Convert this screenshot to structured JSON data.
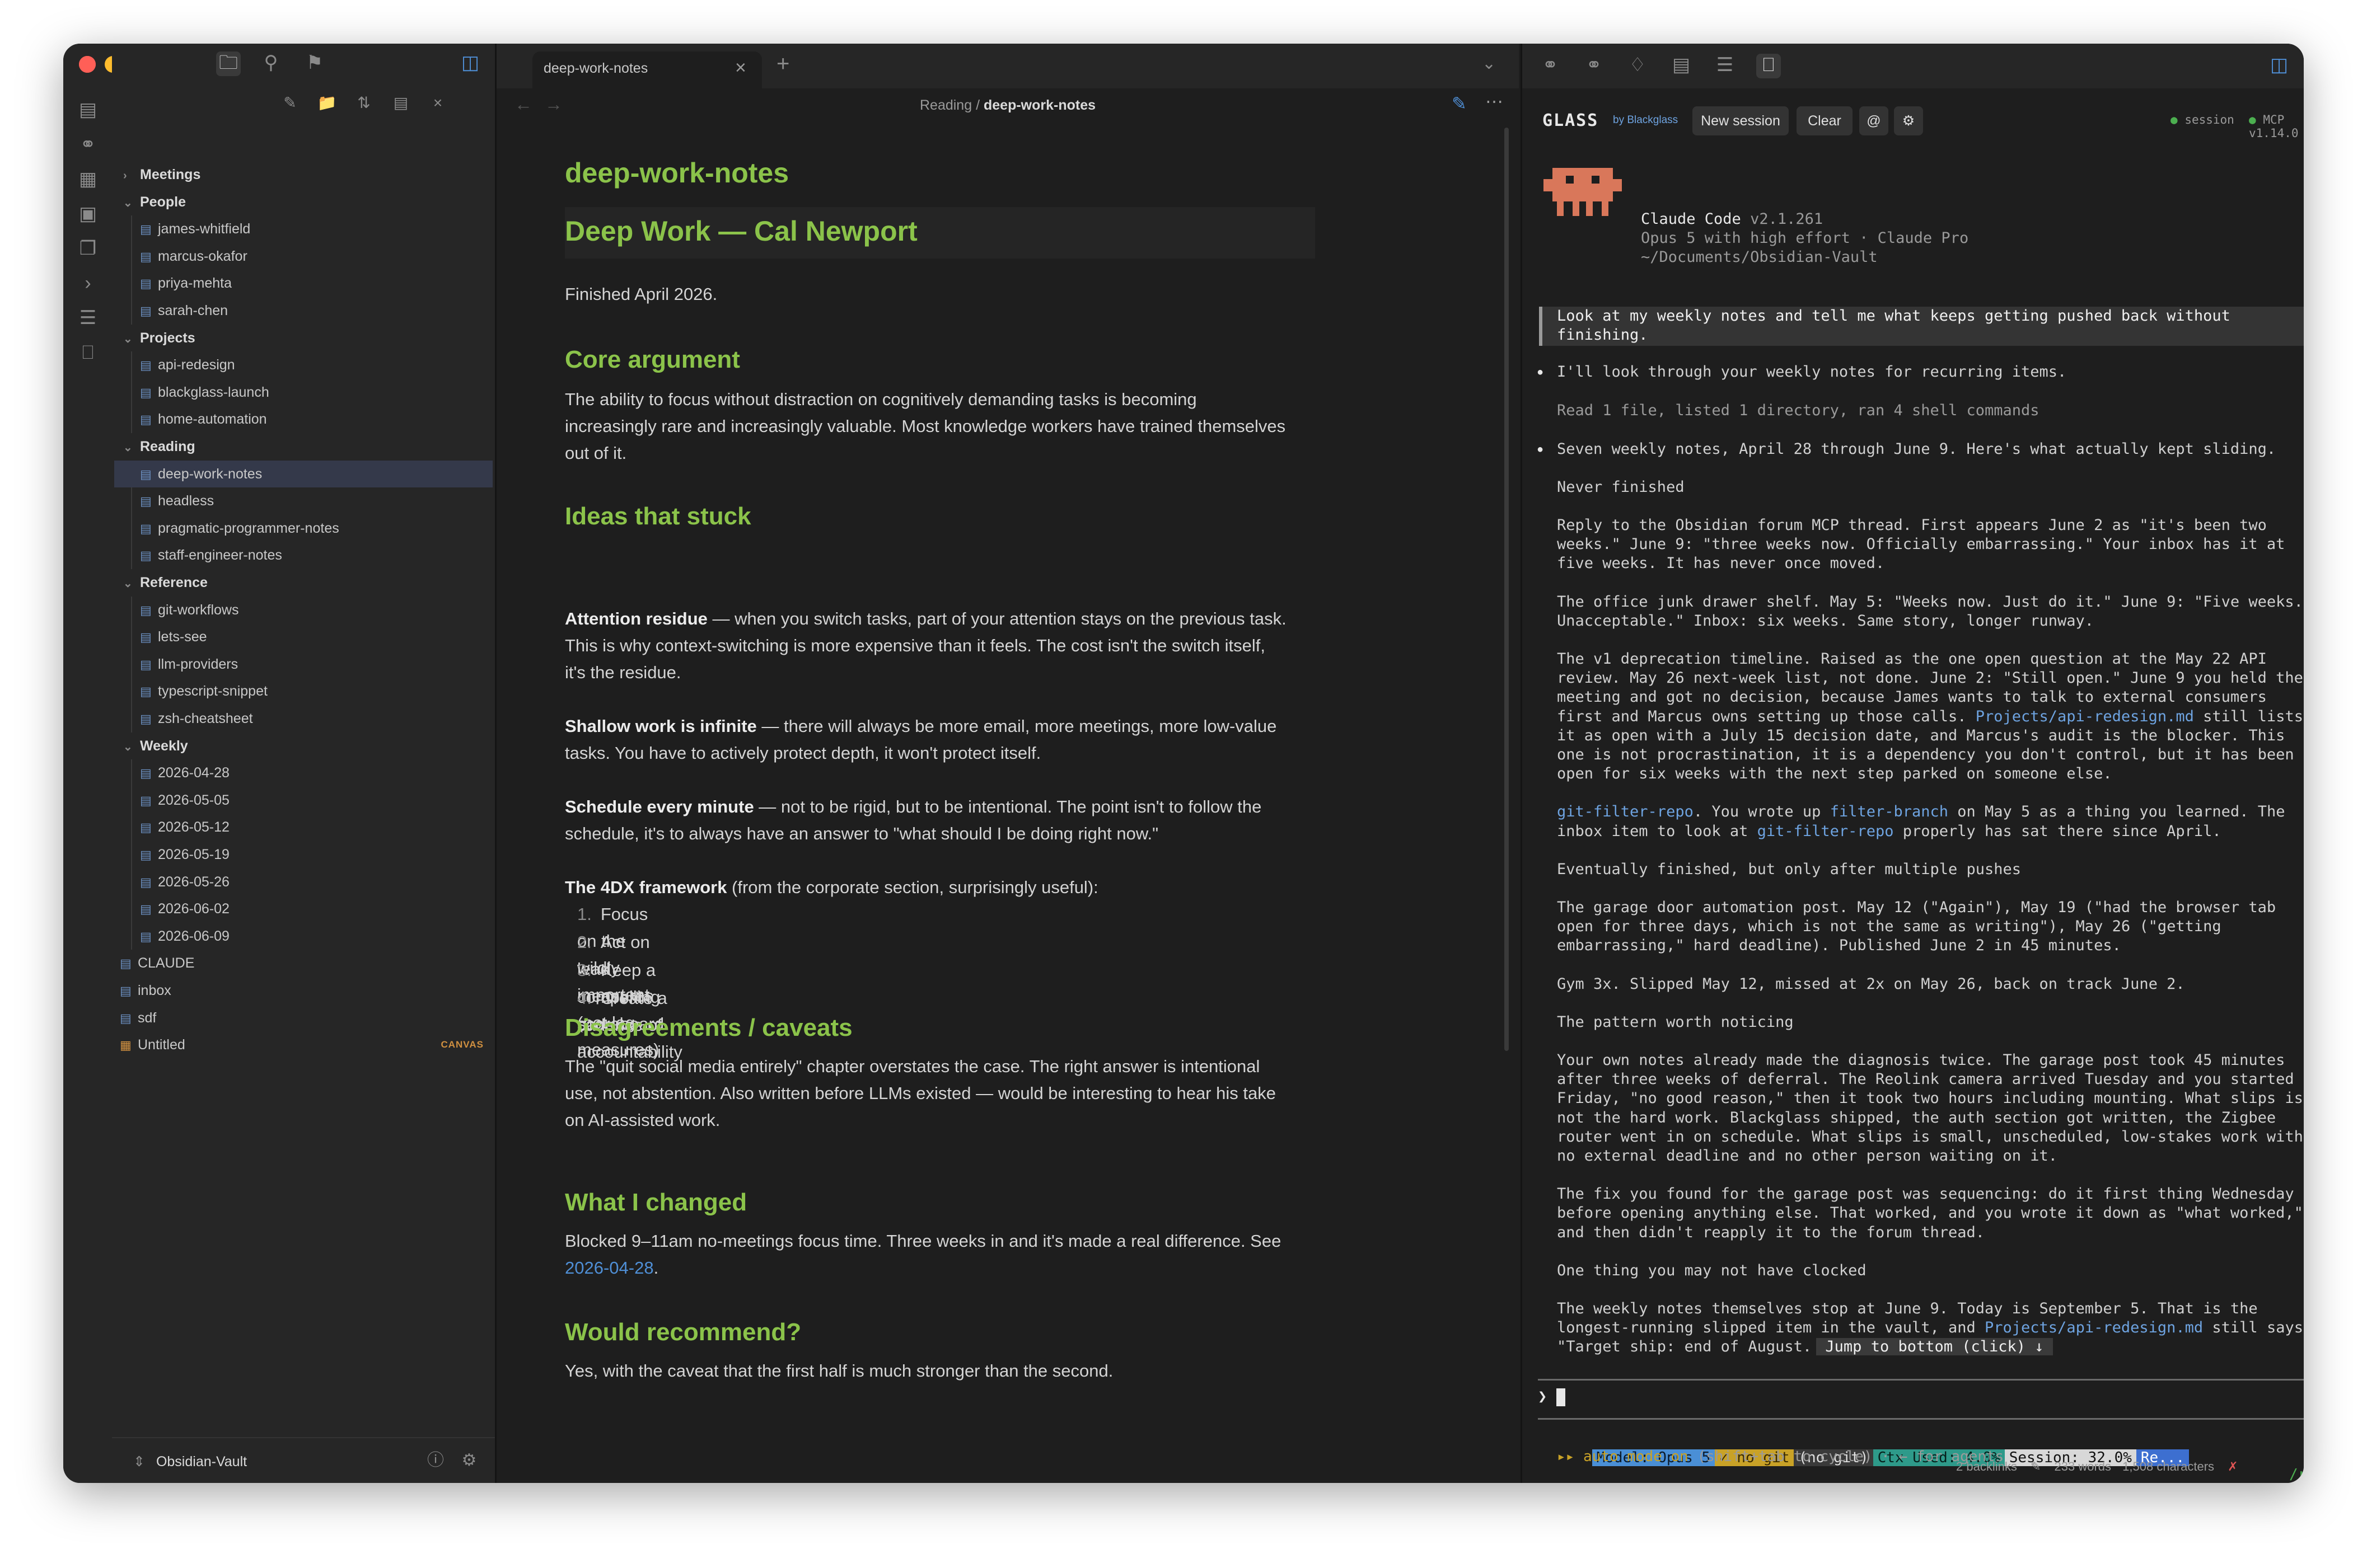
{
  "colors": {
    "accent_green": "#8bc34a",
    "link_blue": "#4f8fd6",
    "traffic_red": "#ff5f57",
    "traffic_yellow": "#febc2e",
    "traffic_green": "#28c840"
  },
  "sidebar": {
    "folders": [
      {
        "label": "Meetings",
        "expanded": false,
        "items": []
      },
      {
        "label": "People",
        "expanded": true,
        "items": [
          "james-whitfield",
          "marcus-okafor",
          "priya-mehta",
          "sarah-chen"
        ]
      },
      {
        "label": "Projects",
        "expanded": true,
        "items": [
          "api-redesign",
          "blackglass-launch",
          "home-automation"
        ]
      },
      {
        "label": "Reading",
        "expanded": true,
        "items": [
          "deep-work-notes",
          "headless",
          "pragmatic-programmer-notes",
          "staff-engineer-notes"
        ]
      },
      {
        "label": "Reference",
        "expanded": true,
        "items": [
          "git-workflows",
          "lets-see",
          "llm-providers",
          "typescript-snippet",
          "zsh-cheatsheet"
        ]
      },
      {
        "label": "Weekly",
        "expanded": true,
        "items": [
          "2026-04-28",
          "2026-05-05",
          "2026-05-12",
          "2026-05-19",
          "2026-05-26",
          "2026-06-02",
          "2026-06-09"
        ]
      }
    ],
    "root_files": [
      "CLAUDE",
      "inbox",
      "sdf"
    ],
    "canvas_file": "Untitled",
    "canvas_badge": "CANVAS",
    "selected": "deep-work-notes",
    "vault_name": "Obsidian-Vault"
  },
  "tab": {
    "title": "deep-work-notes"
  },
  "breadcrumb": {
    "folder": "Reading",
    "sep": "/",
    "file": "deep-work-notes"
  },
  "note": {
    "inline_title": "deep-work-notes",
    "h1": "Deep Work — Cal Newport",
    "finished": "Finished April 2026.",
    "core_h": "Core argument",
    "core_lines": [
      "The ability to focus without distraction on cognitively demanding tasks is becoming",
      "increasingly rare and increasingly valuable. Most knowledge workers have trained themselves",
      "out of it."
    ],
    "ideas_h": "Ideas that stuck",
    "ideas": [
      {
        "bold": "Attention residue",
        "lines": [
          " — when you switch tasks, part of your attention stays on the previous task.",
          "This is why context-switching is more expensive than it feels. The cost isn't the switch itself,",
          "it's the residue."
        ]
      },
      {
        "bold": "Shallow work is infinite",
        "lines": [
          " — there will always be more email, more meetings, more low-value",
          "tasks. You have to actively protect depth, it won't protect itself."
        ]
      },
      {
        "bold": "Schedule every minute",
        "lines": [
          " — not to be rigid, but to be intentional. The point isn't to follow the",
          "schedule, it's to always have an answer to \"what should I be doing right now.\""
        ]
      },
      {
        "bold": "The 4DX framework",
        "lines": [
          " (from the corporate section, surprisingly useful):"
        ]
      }
    ],
    "list": [
      "Focus on the wildly important",
      "Act on lead measures (not lag measures)",
      "Keep a compelling scoreboard",
      "Create a cadence of accountability"
    ],
    "disagree_h": "Disagreements / caveats",
    "disagree_lines": [
      "The \"quit social media entirely\" chapter overstates the case. The right answer is intentional",
      "use, not abstention. Also written before LLMs existed — would be interesting to hear his take",
      "on AI-assisted work."
    ],
    "changed_h": "What I changed",
    "changed_line": "Blocked 9–11am no-meetings focus time. Three weeks in and it's made a real difference. See",
    "changed_link": "2026-04-28",
    "changed_tail": ".",
    "recommend_h": "Would recommend?",
    "recommend_line": "Yes, with the caveat that the first half is much stronger than the second."
  },
  "glass": {
    "brand": "GLASS",
    "by": "by Blackglass",
    "new_session": "New session",
    "clear": "Clear",
    "at": "@",
    "session_label": "session",
    "mcp_label": "MCP v1.14.0",
    "app_name": "Claude Code",
    "version": "v2.1.261",
    "model_line": "Opus 5 with high effort · Claude Pro",
    "path_line": "~/Documents/Obsidian-Vault",
    "user_msg": [
      "Look at my weekly notes and tell me what keeps getting pushed back without",
      "finishing."
    ],
    "bullet1": "I'll look through your weekly notes for recurring items.",
    "tool_line": "Read 1 file, listed 1 directory, ran 4 shell commands",
    "bullet2": "Seven weekly notes, April 28 through June 9. Here's what actually kept sliding.",
    "sec_never": "Never finished",
    "para1": [
      "Reply to the Obsidian forum MCP thread. First appears June 2 as \"it's been two",
      "weeks.\" June 9: \"three weeks now. Officially embarrassing.\" Your inbox has it at",
      "five weeks. It has never once moved."
    ],
    "para2": [
      "The office junk drawer shelf. May 5: \"Weeks now. Just do it.\" June 9: \"Five weeks.",
      "Unacceptable.\" Inbox: six weeks. Same story, longer runway."
    ],
    "para3a": [
      "The v1 deprecation timeline. Raised as the one open question at the May 22 API",
      "review. May 26 next-week list, not done. June 2: \"Still open.\" June 9 you held the",
      "meeting and got no decision, because James wants to talk to external consumers"
    ],
    "para3_link_pre": "first and Marcus owns setting up those calls. ",
    "para3_link": "Projects/api-redesign.md",
    "para3_link_post": " still lists",
    "para3b": [
      "it as open with a July 15 decision date, and Marcus's audit is the blocker. This",
      "one is not procrastination, it is a dependency you don't control, but it has been",
      "open for six weeks with the next step parked on someone else."
    ],
    "para4_code1": "git-filter-repo",
    "para4_t1": ". You wrote up ",
    "para4_code2": "filter-branch",
    "para4_t2": " on May 5 as a thing you learned. The",
    "para4_t3": "inbox item to look at ",
    "para4_code3": "git-filter-repo",
    "para4_t4": " properly has sat there since April.",
    "sec_eventually": "Eventually finished, but only after multiple pushes",
    "para5": [
      "The garage door automation post. May 12 (\"Again\"), May 19 (\"had the browser tab",
      "open for three days, which is not the same as writing\"), May 26 (\"getting",
      "embarrassing,\" hard deadline). Published June 2 in 45 minutes."
    ],
    "para6": "Gym 3x. Slipped May 12, missed at 2x on May 26, back on track June 2.",
    "sec_pattern": "The pattern worth noticing",
    "para7": [
      "Your own notes already made the diagnosis twice. The garage post took 45 minutes",
      "after three weeks of deferral. The Reolink camera arrived Tuesday and you started",
      "Friday, \"no good reason,\" then it took two hours including mounting. What slips is",
      "not the hard work. Blackglass shipped, the auth section got written, the Zigbee",
      "router went in on schedule. What slips is small, unscheduled, low-stakes work with",
      "no external deadline and no other person waiting on it."
    ],
    "para8": [
      "The fix you found for the garage post was sequencing: do it first thing Wednesday",
      "before opening anything else. That worked, and you wrote it down as \"what worked,\"",
      "and then didn't reapply it to the forum thread."
    ],
    "sec_clocked": "One thing you may not have clocked",
    "para9a": "The weekly notes themselves stop at June 9. Today is September 5. That is the",
    "para9b_pre": "longest-running slipped item in the vault, and ",
    "para9b_link": "Projects/api-redesign.md",
    "para9b_post": " still says",
    "para9c": "\"Target ship: end of August.",
    "jump": " Jump to bottom (click) ↓ ",
    "prompt": "❯",
    "status": {
      "model": "Model: Opus 5",
      "git": "✓ no git",
      "nogit": "(no git)",
      "ctx": "Ctx Used: 4.0%",
      "session": "Session: 32.0%",
      "re": "Re..."
    },
    "automode": "▸▸ auto mode on",
    "automode_hint": " (shift+tab to cycle) · ← for agents",
    "rc": "/rc"
  },
  "statusbar": {
    "backlinks": "2 backlinks",
    "words": "233 words",
    "chars": "1,508 characters"
  }
}
